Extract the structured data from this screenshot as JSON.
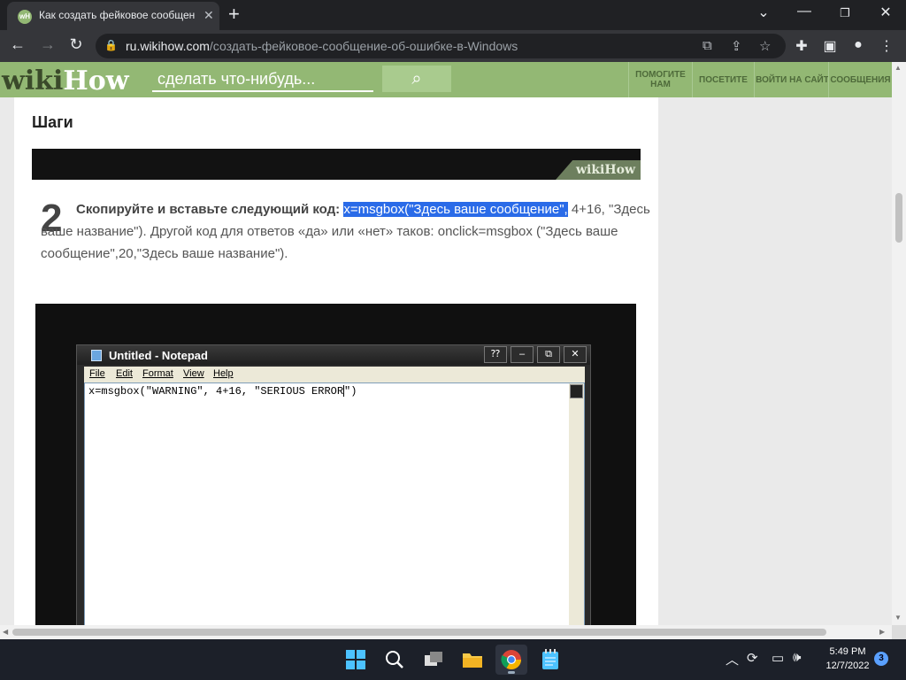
{
  "browser": {
    "tab_title": "Как создать фейковое сообщение об ошибке в Windows",
    "url_host": "ru.wikihow.com",
    "url_path": "/создать-фейковое-сообщение-об-ошибке-в-Windows"
  },
  "site": {
    "logo_part1": "wiki",
    "logo_part2": "How",
    "search_placeholder": "сделать что-нибудь...",
    "nav": [
      "ПОМОГИТЕ НАМ",
      "ПОСЕТИТЕ",
      "ВОЙТИ НА САЙТ",
      "СООБЩЕНИЯ"
    ]
  },
  "article": {
    "section_heading": "Шаги",
    "watermark": "wikiHow",
    "step_number": "2",
    "step_bold": "Скопируйте и вставьте следующий код:",
    "step_selected": "x=msgbox(\"Здесь ваше сообщение\",",
    "step_rest": " 4+16, \"Здесь ваше название\"). Другой код для ответов «да» или «нет» таков: onclick=msgbox (\"Здесь ваше сообщение\",20,\"Здесь ваше название\")."
  },
  "notepad": {
    "title": "Untitled - Notepad",
    "menu": [
      "File",
      "Edit",
      "Format",
      "View",
      "Help"
    ],
    "text_before_caret": "x=msgbox(\"WARNING\", 4+16, \"SERIOUS ERROR",
    "text_after_caret": "\")"
  },
  "taskbar": {
    "time": "5:49 PM",
    "date": "12/7/2022",
    "notification_count": "3"
  },
  "colors": {
    "wikihow_green": "#93b874",
    "selection_blue": "#2a6be8",
    "chrome_dark": "#202124"
  }
}
